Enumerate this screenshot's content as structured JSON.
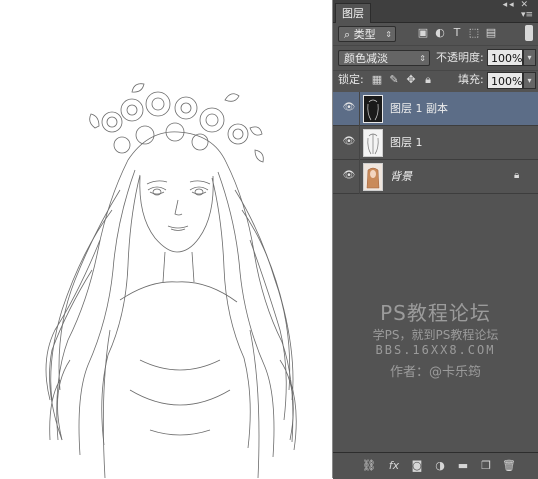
{
  "panel": {
    "tab_label": "图层",
    "filter": {
      "kind_label": "类型"
    },
    "blend": {
      "mode": "颜色减淡",
      "opacity_label": "不透明度:",
      "opacity_value": "100%"
    },
    "lock": {
      "label": "锁定:",
      "fill_label": "填充:",
      "fill_value": "100%"
    },
    "layers": [
      {
        "name": "图层 1 副本",
        "selected": true,
        "visible": true,
        "locked": false
      },
      {
        "name": "图层 1",
        "selected": false,
        "visible": true,
        "locked": false
      },
      {
        "name": "背景",
        "selected": false,
        "visible": true,
        "locked": true
      }
    ],
    "watermark": {
      "title": "PS教程论坛",
      "line1": "学PS，就到PS教程论坛",
      "line2": "BBS.16XX8.COM",
      "author": "作者：@卡乐筠"
    }
  },
  "colors": {
    "panel_bg": "#535353",
    "selected_layer": "#5c6d87",
    "canvas_bg": "#ffffff"
  }
}
